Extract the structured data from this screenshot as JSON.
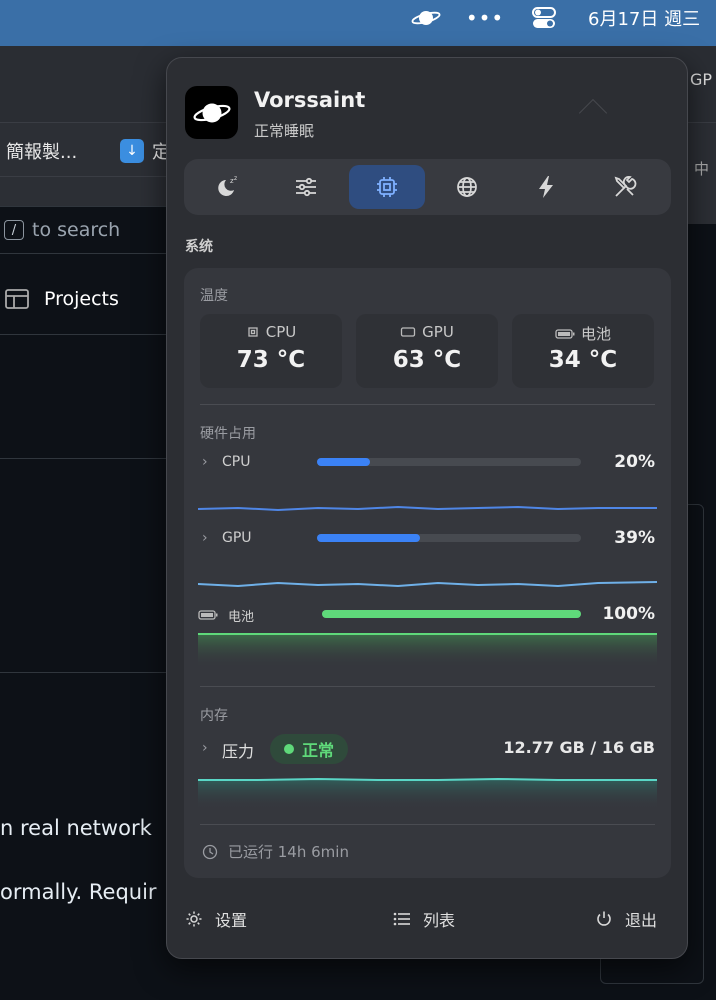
{
  "menubar": {
    "date": "6月17日 週三",
    "dots_icon": "more-icon",
    "saturn_icon": "saturn-icon",
    "toggle_icon": "control-center-icon"
  },
  "background": {
    "bookmark_1": "簡報製...",
    "bookmark_2": "定",
    "right_tab": "GP",
    "right_text": "中",
    "search_placeholder": "to search",
    "search_key": "/",
    "projects_label": "Projects",
    "text_line_1": "n real network",
    "text_line_2": "ormally. Requir"
  },
  "app": {
    "name": "Vorssaint",
    "status": "正常睡眠"
  },
  "tabs": [
    {
      "icon": "sleep-moon-icon"
    },
    {
      "icon": "sliders-icon"
    },
    {
      "icon": "chip-icon",
      "active": true
    },
    {
      "icon": "globe-icon"
    },
    {
      "icon": "bolt-icon"
    },
    {
      "icon": "tools-icon"
    }
  ],
  "system": {
    "section_title": "系统",
    "temperature_title": "温度",
    "temps": [
      {
        "label": "CPU",
        "value": "73 °C",
        "icon": "cpu-icon"
      },
      {
        "label": "GPU",
        "value": "63 °C",
        "icon": "gpu-icon"
      },
      {
        "label": "电池",
        "value": "34 °C",
        "icon": "battery-icon"
      }
    ],
    "usage_title": "硬件占用",
    "usage": [
      {
        "label": "CPU",
        "percent_text": "20%",
        "fraction": 0.2,
        "color": "#3b82f6",
        "line_color": "#4f86e6"
      },
      {
        "label": "GPU",
        "percent_text": "39%",
        "fraction": 0.39,
        "color": "#3b82f6",
        "line_color": "#6fb0e8"
      },
      {
        "label": "电池",
        "percent_text": "100%",
        "fraction": 1.0,
        "color": "#5fd97a",
        "line_color": "#5fd97a"
      }
    ],
    "memory_title": "内存",
    "pressure_label": "压力",
    "pressure_status": "正常",
    "memory_value": "12.77 GB / 16 GB",
    "uptime": "已运行 14h 6min"
  },
  "footer": {
    "settings": "设置",
    "list": "列表",
    "quit": "退出"
  },
  "colors": {
    "accent": "#2f4d80",
    "green": "#5fd97a",
    "teal": "#5ad6c6"
  }
}
